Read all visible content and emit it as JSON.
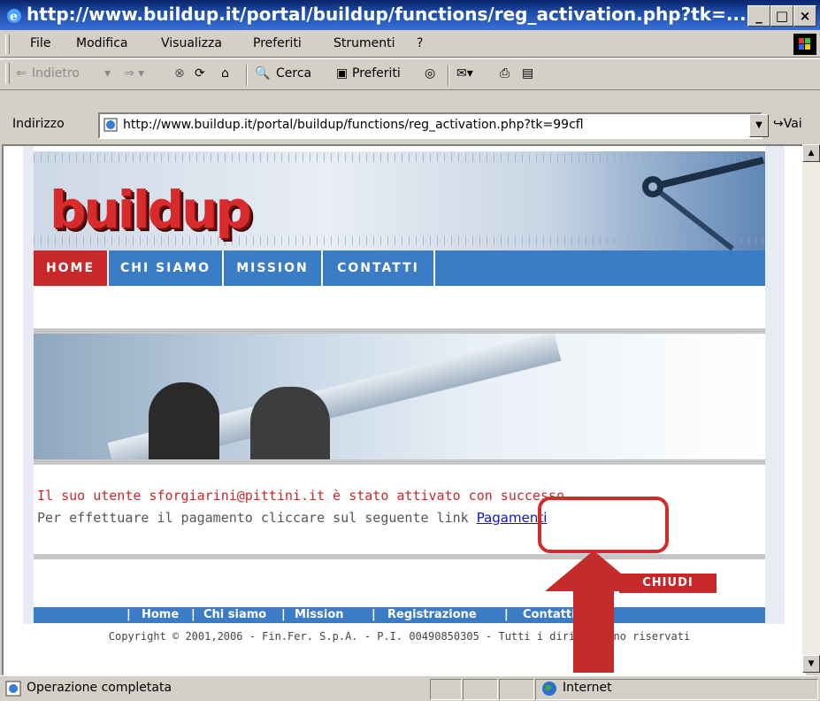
{
  "window": {
    "title": "http://www.buildup.it/portal/buildup/functions/reg_activation.php?tk=..."
  },
  "menu": [
    "File",
    "Modifica",
    "Visualizza",
    "Preferiti",
    "Strumenti",
    "?"
  ],
  "toolbar": {
    "back": "Indietro",
    "search": "Cerca",
    "favorites": "Preferiti"
  },
  "address": {
    "label": "Indirizzo",
    "url": "http://www.buildup.it/portal/buildup/functions/reg_activation.php?tk=99cfl",
    "go": "Vai"
  },
  "site": {
    "logo": "buildup",
    "nav": [
      "HOME",
      "CHI SIAMO",
      "MISSION",
      "CONTATTI"
    ],
    "message_line1": "Il suo utente sforgiarini@pittini.it è stato attivato con successo",
    "message_line2": "Per effettuare il pagamento cliccare sul seguente link",
    "payment_link": "Pagamenti",
    "close_button": "CHIUDI",
    "footer_links": [
      "Home",
      "Chi siamo",
      "Mission",
      "Registrazione",
      "Contatti"
    ],
    "copyright": "Copyright © 2001,2006 - Fin.Fer. S.p.A. - P.I. 00490850305 - Tutti i diritti sono riservati"
  },
  "status": {
    "text": "Operazione completata",
    "zone": "Internet"
  },
  "colors": {
    "accent_red": "#c8282a",
    "nav_blue": "#3b7cc6",
    "annotation_red": "#d42a2a"
  }
}
